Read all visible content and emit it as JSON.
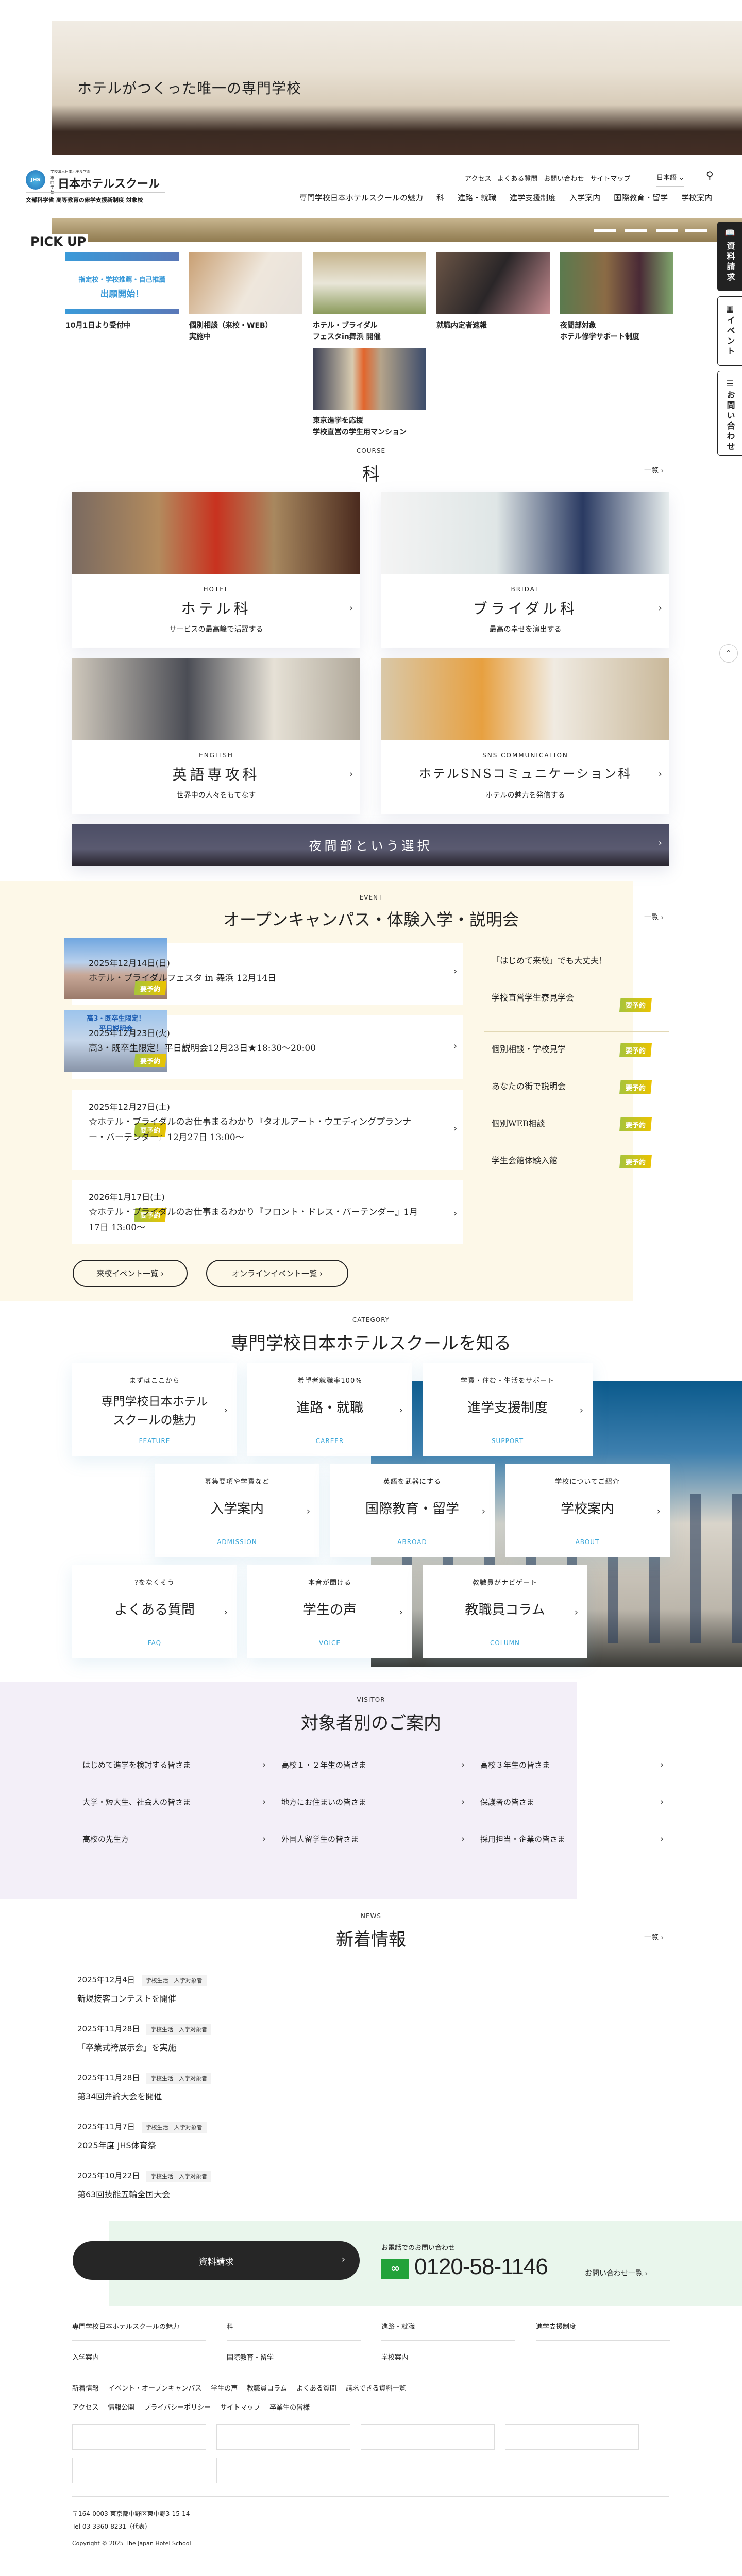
{
  "hero": {
    "title": "ホテルがつくった唯一の専門学校"
  },
  "header": {
    "logo": {
      "corp": "学校法人日本ホテル学園",
      "kind": "専門学校",
      "name": "日本ホテルスクール",
      "mark": "JHS",
      "tagline": "文部科学省 高等教育の修学支援新制度 対象校"
    },
    "top_nav": [
      "アクセス",
      "よくある質問",
      "お問い合わせ",
      "サイトマップ"
    ],
    "language": "日本語",
    "search_icon": "search-icon",
    "main_nav": [
      "専門学校日本ホテルスクールの魅力",
      "科",
      "進路・就職",
      "進学支援制度",
      "入学案内",
      "国際教育・留学",
      "学校案内"
    ]
  },
  "side_tabs": [
    "資料請求",
    "イベント",
    "お問い合わせ"
  ],
  "pickup": {
    "label": "PICK UP",
    "banner_text": "指定校・学校推薦・自己推薦",
    "banner_text2": "出願開始！",
    "items": [
      "10月1日より受付中",
      "個別相談（来校・WEB）\n実施中",
      "ホテル・ブライダル\nフェスタin舞浜 開催",
      "就職内定者速報",
      "夜間部対象\nホテル修学サポート制度",
      "東京進学を応援\n学校直営の学生用マンション"
    ]
  },
  "course": {
    "en": "COURSE",
    "title": "科",
    "more": "一覧 ›",
    "items": [
      {
        "en": "HOTEL",
        "title": "ホテル科",
        "sub": "サービスの最高峰で活躍する"
      },
      {
        "en": "BRIDAL",
        "title": "ブライダル科",
        "sub": "最高の幸せを演出する"
      },
      {
        "en": "ENGLISH",
        "title": "英語専攻科",
        "sub": "世界中の人々をもてなす"
      },
      {
        "en": "SNS COMMUNICATION",
        "title": "ホテルSNSコミュニケーション科",
        "sub": "ホテルの魅力を発信する"
      }
    ],
    "night": "夜間部という選択"
  },
  "event": {
    "en": "EVENT",
    "title": "オープンキャンパス・体験入学・説明会",
    "more": "一覧 ›",
    "badge": "要予約",
    "img2_text": "高3・既卒生限定！\n平日説明会",
    "items": [
      {
        "date": "2025年12月14日(日)",
        "title": "ホテル・ブライダルフェスタ in 舞浜 12月14日"
      },
      {
        "date": "2025年12月23日(火)",
        "title": "高3・既卒生限定！平日説明会12月23日★18:30～20:00"
      },
      {
        "date": "2025年12月27日(土)",
        "title": "☆ホテル・ブライダルのお仕事まるわかり『タオルアート・ウエディングプランナー・バーテンダー』12月27日 13:00～"
      },
      {
        "date": "2026年1月17日(土)",
        "title": "☆ホテル・ブライダルのお仕事まるわかり『フロント・ドレス・バーテンダー』1月17日 13:00～"
      }
    ],
    "list": [
      "「はじめて来校」でも大丈夫！",
      "学校直営学生寮見学会",
      "個別相談・学校見学",
      "あなたの街で説明会",
      "個別WEB相談",
      "学生会館体験入館"
    ],
    "buttons": [
      "来校イベント一覧 ›",
      "オンラインイベント一覧 ›"
    ]
  },
  "category": {
    "en": "CATEGORY",
    "title": "専門学校日本ホテルスクールを知る",
    "items": [
      {
        "l": "まずはここから",
        "t": "専門学校日本ホテル\nスクールの魅力",
        "e": "FEATURE"
      },
      {
        "l": "希望者就職率100%",
        "t": "進路・就職",
        "e": "CAREER"
      },
      {
        "l": "学費・住む・生活をサポート",
        "t": "進学支援制度",
        "e": "SUPPORT"
      },
      {
        "l": "募集要項や学費など",
        "t": "入学案内",
        "e": "ADMISSION"
      },
      {
        "l": "英語を武器にする",
        "t": "国際教育・留学",
        "e": "ABROAD"
      },
      {
        "l": "学校についてご紹介",
        "t": "学校案内",
        "e": "ABOUT"
      },
      {
        "l": "?をなくそう",
        "t": "よくある質問",
        "e": "FAQ"
      },
      {
        "l": "本音が聞ける",
        "t": "学生の声",
        "e": "VOICE"
      },
      {
        "l": "教職員がナビゲート",
        "t": "教職員コラム",
        "e": "COLUMN"
      }
    ]
  },
  "visitor": {
    "en": "VISITOR",
    "title": "対象者別のご案内",
    "items": [
      "はじめて進学を検討する皆さま",
      "高校１・２年生の皆さま",
      "高校３年生の皆さま",
      "大学・短大生、社会人の皆さま",
      "地方にお住まいの皆さま",
      "保護者の皆さま",
      "高校の先生方",
      "外国人留学生の皆さま",
      "採用担当・企業の皆さま"
    ]
  },
  "news": {
    "en": "NEWS",
    "title": "新着情報",
    "more": "一覧 ›",
    "tags": [
      "学校生活",
      "入学対象者"
    ],
    "items": [
      {
        "date": "2025年12月4日",
        "title": "新規接客コンテストを開催"
      },
      {
        "date": "2025年11月28日",
        "title": "「卒業式袴展示会」を実施"
      },
      {
        "date": "2025年11月28日",
        "title": "第34回弁論大会を開催"
      },
      {
        "date": "2025年11月7日",
        "title": "2025年度 JHS体育祭"
      },
      {
        "date": "2025年10月22日",
        "title": "第63回技能五輪全国大会"
      }
    ]
  },
  "contact": {
    "request": "資料請求",
    "phone_label": "お電話でのお問い合わせ",
    "phone": "0120-58-1146",
    "list_link": "お問い合わせ一覧 ›"
  },
  "footer": {
    "nav": [
      "専門学校日本ホテルスクールの魅力",
      "科",
      "進路・就職",
      "進学支援制度",
      "入学案内",
      "国際教育・留学",
      "学校案内"
    ],
    "links1": [
      "新着情報",
      "イベント・オープンキャンパス",
      "学生の声",
      "教職員コラム",
      "よくある質問",
      "請求できる資料一覧"
    ],
    "links2": [
      "アクセス",
      "情報公開",
      "プライバシーポリシー",
      "サイトマップ",
      "卒業生の皆様"
    ],
    "address": "〒164-0003 東京都中野区東中野3-15-14",
    "tel": "Tel 03-3360-8231（代表）",
    "copyright": "Copyright © 2025 The Japan Hotel School"
  }
}
